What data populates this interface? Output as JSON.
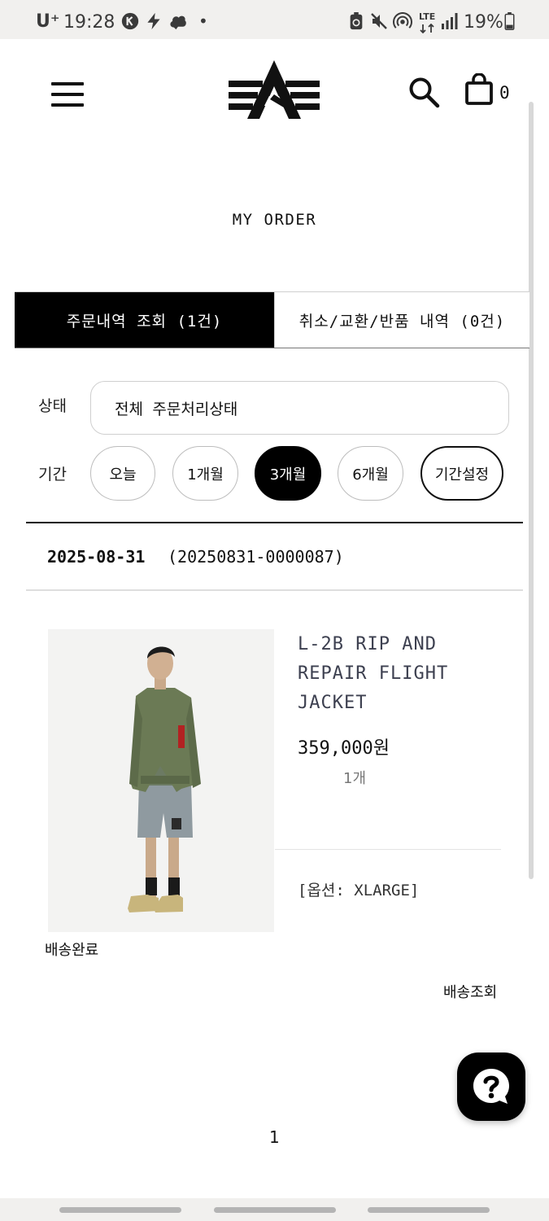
{
  "status_bar": {
    "carrier": "U⁺",
    "time": "19:28",
    "dot": "•",
    "network": "LTE",
    "battery": "19%"
  },
  "header": {
    "cart_count": "0"
  },
  "page": {
    "title": "MY ORDER"
  },
  "tabs": [
    {
      "label": "주문내역 조회 (1건)",
      "active": true
    },
    {
      "label": "취소/교환/반품 내역 (0건)",
      "active": false
    }
  ],
  "filters": {
    "status_label": "상태",
    "status_value": "전체 주문처리상태",
    "period_label": "기간",
    "periods": [
      "오늘",
      "1개월",
      "3개월",
      "6개월",
      "기간설정"
    ],
    "selected_period": "3개월"
  },
  "order": {
    "date": "2025-08-31",
    "number": "(20250831-0000087)",
    "product": {
      "name": "L-2B RIP AND REPAIR FLIGHT JACKET",
      "price": "359,000원",
      "quantity": "1개",
      "option": "[옵션: XLARGE]"
    },
    "status": "배송완료",
    "track_label": "배송조회"
  },
  "pagination": {
    "current": "1"
  },
  "colors": {
    "primary": "#000000",
    "product_name": "#3d4050",
    "border": "#cfcfcf",
    "jacket": "#6b7a55",
    "shorts": "#8f9aa0"
  }
}
